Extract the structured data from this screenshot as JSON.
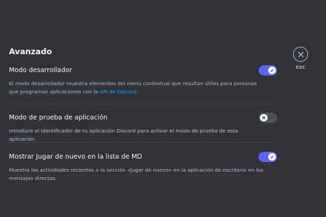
{
  "section_title": "Avanzado",
  "settings": [
    {
      "label": "Modo desarrollador",
      "desc_before_link": "El modo desarrollador muestra elementos del menú contextual que resultan útiles para personas que programan aplicaciones con la ",
      "link": "API de Discord",
      "desc_after_link": ".",
      "enabled": true
    },
    {
      "label": "Modo de prueba de aplicación",
      "description": "Introduce el identificador de tu aplicación Discord para activar el modo de prueba de esta aplicación.",
      "enabled": false
    },
    {
      "label": "Mostrar Jugar de nuevo en la lista de MD",
      "description": "Muestra las actividades recientes o la sección «Jugar de nuevo» en la aplicación de escritorio en los mensajes directos.",
      "enabled": true
    }
  ],
  "close": {
    "label": "ESC",
    "icon": "close-icon"
  },
  "colors": {
    "background": "#313338",
    "toggle_on": "#5865f2",
    "toggle_off": "#4e5058",
    "link": "#00a8fc"
  }
}
